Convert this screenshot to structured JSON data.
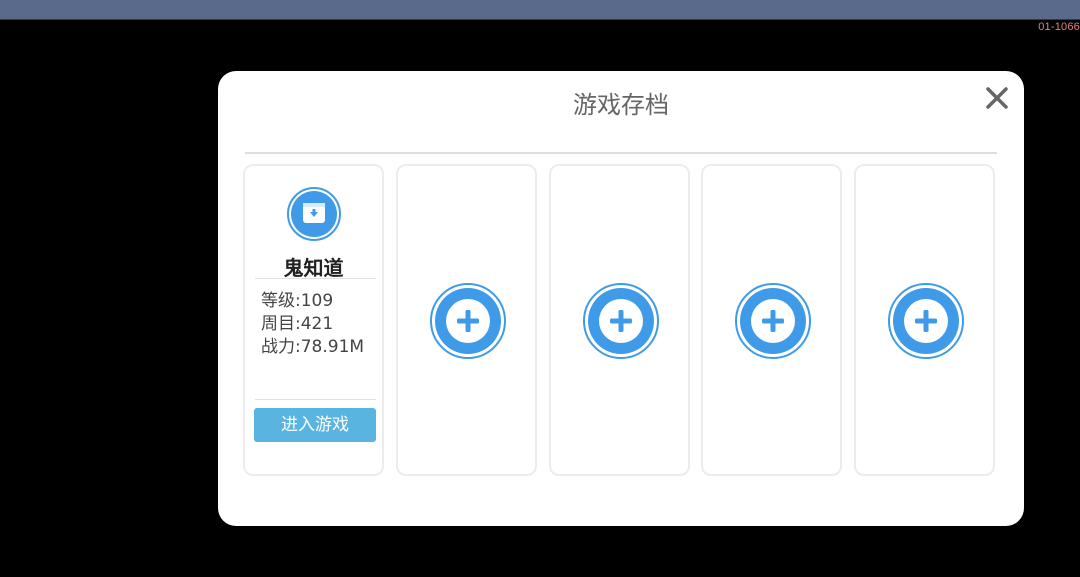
{
  "corner_tag": "01-1066",
  "dialog": {
    "title": "游戏存档"
  },
  "saved_slot": {
    "name": "鬼知道",
    "level": "等级:109",
    "cycle": "周目:421",
    "power": "战力:78.91M",
    "enter_label": "进入游戏"
  },
  "empty_slots_count": 4,
  "icons": {
    "close": "close-icon",
    "save": "save-icon",
    "add": "plus-icon"
  },
  "colors": {
    "accent_blue": "#3f9be8",
    "enter_button": "#5ab4e0",
    "top_bar": "#5a6a8a",
    "background": "#000000"
  }
}
